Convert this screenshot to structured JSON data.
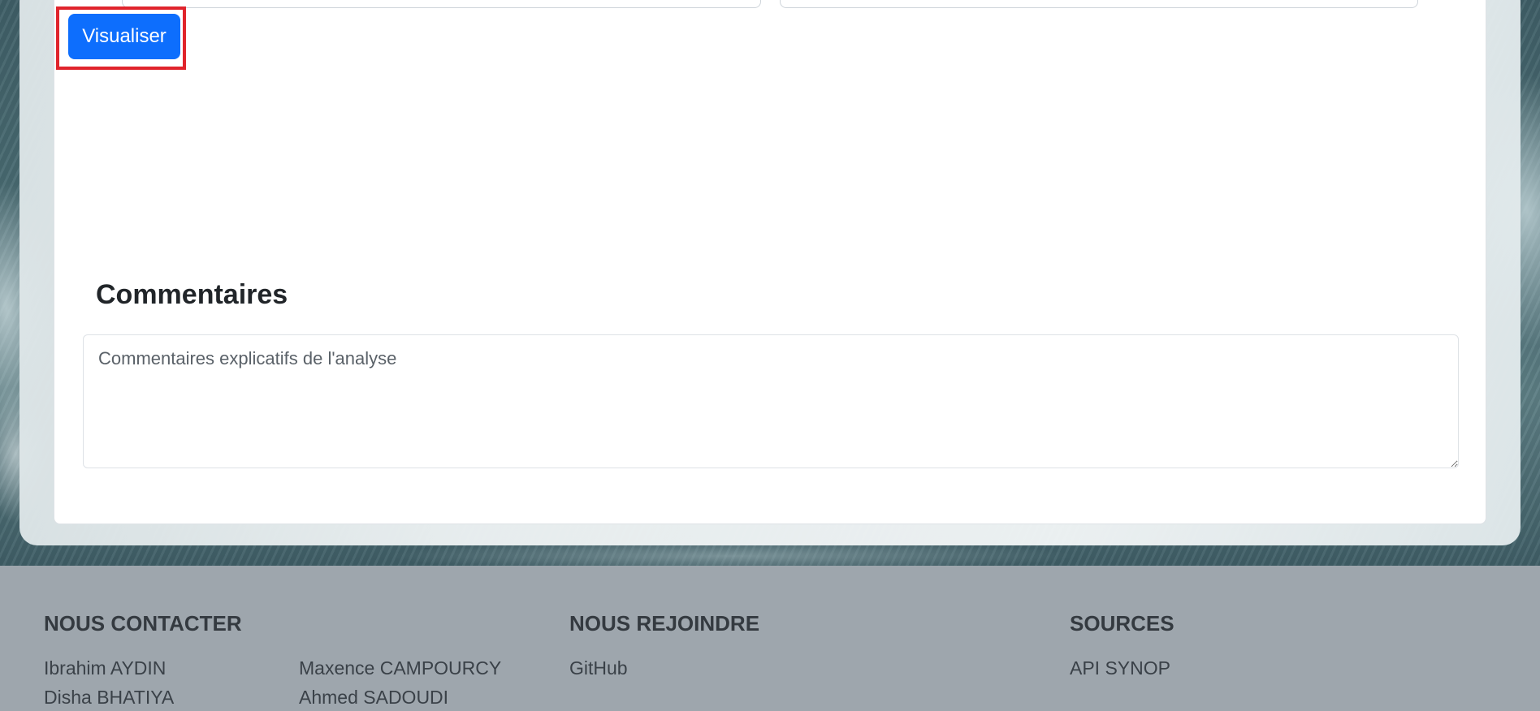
{
  "form": {
    "visualiser_label": "Visualiser"
  },
  "comments": {
    "title": "Commentaires",
    "placeholder": "Commentaires explicatifs de l'analyse"
  },
  "footer": {
    "contact": {
      "heading": "NOUS CONTACTER",
      "people": [
        "Ibrahim AYDIN",
        "Maxence CAMPOURCY",
        "Disha BHATIYA",
        "Ahmed SADOUDI"
      ]
    },
    "join": {
      "heading": "NOUS REJOINDRE",
      "links": [
        "GitHub"
      ]
    },
    "sources": {
      "heading": "SOURCES",
      "links": [
        "API SYNOP"
      ]
    }
  }
}
